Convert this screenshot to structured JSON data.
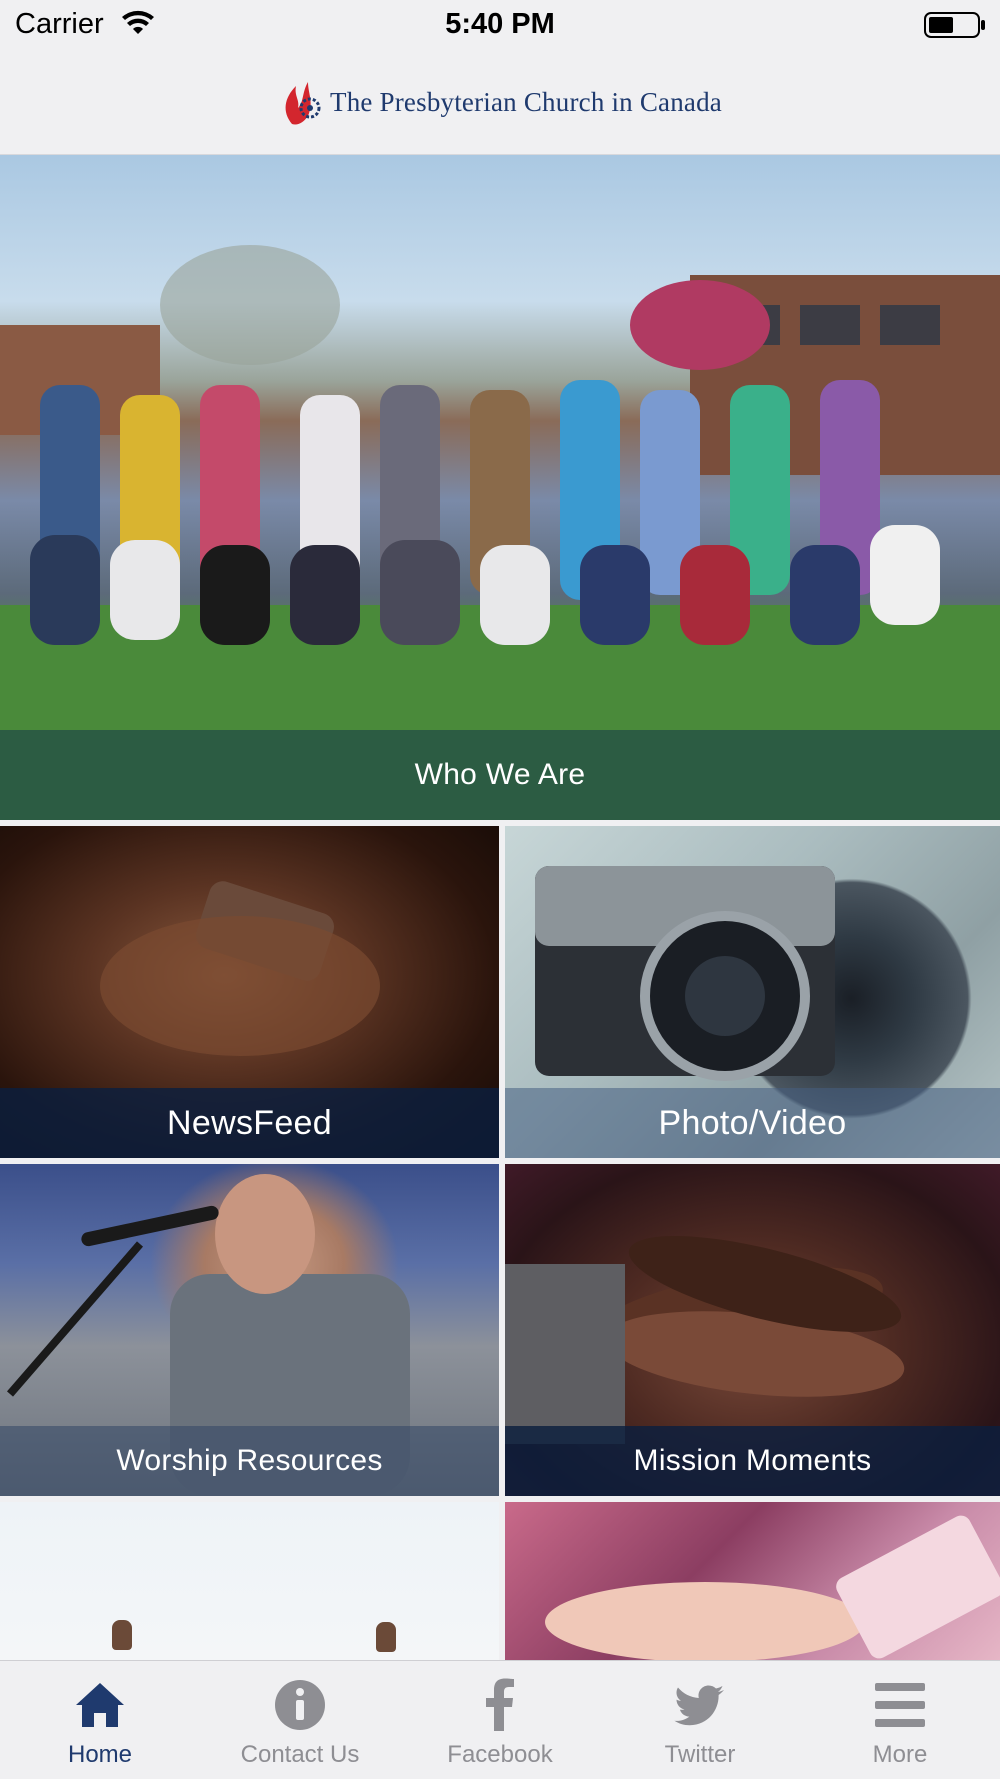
{
  "status_bar": {
    "carrier": "Carrier",
    "time": "5:40 PM"
  },
  "header": {
    "logo_text": "The Presbyterian Church in Canada"
  },
  "tiles": {
    "hero": {
      "label": "Who We Are"
    },
    "newsfeed": {
      "label": "NewsFeed"
    },
    "photo_video": {
      "label": "Photo/Video"
    },
    "worship": {
      "label": "Worship Resources"
    },
    "mission": {
      "label": "Mission Moments"
    }
  },
  "tab_bar": {
    "items": [
      {
        "label": "Home",
        "icon": "home-icon",
        "active": true
      },
      {
        "label": "Contact Us",
        "icon": "info-icon",
        "active": false
      },
      {
        "label": "Facebook",
        "icon": "facebook-icon",
        "active": false
      },
      {
        "label": "Twitter",
        "icon": "twitter-icon",
        "active": false
      },
      {
        "label": "More",
        "icon": "menu-icon",
        "active": false
      }
    ]
  },
  "colors": {
    "accent": "#1f3a6e",
    "inactive": "#8e8e93",
    "caption_band": "#0b1e3e"
  }
}
